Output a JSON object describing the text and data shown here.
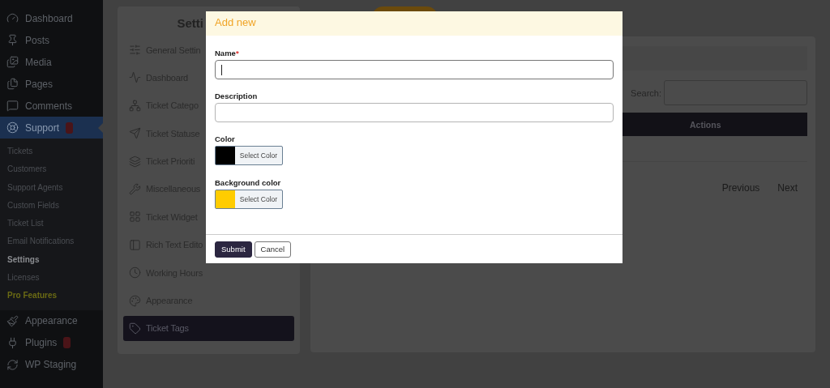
{
  "admin_menu": [
    {
      "label": "Dashboard",
      "selected": false,
      "badge": false
    },
    {
      "label": "Posts",
      "selected": false,
      "badge": false
    },
    {
      "label": "Media",
      "selected": false,
      "badge": false
    },
    {
      "label": "Pages",
      "selected": false,
      "badge": false
    },
    {
      "label": "Comments",
      "selected": false,
      "badge": false
    },
    {
      "label": "Support",
      "selected": true,
      "badge": true,
      "submenu": [
        {
          "label": "Tickets",
          "kind": "normal",
          "selected": false
        },
        {
          "label": "Customers",
          "kind": "normal",
          "selected": false
        },
        {
          "label": "Support Agents",
          "kind": "normal",
          "selected": false
        },
        {
          "label": "Custom Fields",
          "kind": "normal",
          "selected": false
        },
        {
          "label": "Ticket List",
          "kind": "normal",
          "selected": false
        },
        {
          "label": "Email Notifications",
          "kind": "normal",
          "selected": false
        },
        {
          "label": "Settings",
          "kind": "normal",
          "selected": true
        },
        {
          "label": "Licenses",
          "kind": "normal",
          "selected": false
        },
        {
          "label": "Pro Features",
          "kind": "pro",
          "selected": false
        }
      ]
    },
    {
      "label": "Appearance",
      "selected": false,
      "badge": false
    },
    {
      "label": "Plugins",
      "selected": false,
      "badge": true
    },
    {
      "label": "WP Staging",
      "selected": false,
      "badge": false
    }
  ],
  "settings_panel": {
    "title": "Setti",
    "items": [
      {
        "label": "General Settin",
        "selected": false
      },
      {
        "label": "Dashboard",
        "selected": false
      },
      {
        "label": "Ticket Catego",
        "selected": false
      },
      {
        "label": "Ticket Statuse",
        "selected": false
      },
      {
        "label": "Ticket Prioriti",
        "selected": false
      },
      {
        "label": "Miscellaneous",
        "selected": false
      },
      {
        "label": "Ticket Widget",
        "selected": false
      },
      {
        "label": "Rich Text Edito",
        "selected": false
      },
      {
        "label": "Working Hours",
        "selected": false
      },
      {
        "label": "Appearance",
        "selected": false
      },
      {
        "label": "Ticket Tags",
        "selected": true
      }
    ]
  },
  "content": {
    "search_label": "Search:",
    "table": {
      "columns": [
        "Actions"
      ]
    },
    "pagination": [
      "Previous",
      "Next"
    ]
  },
  "modal": {
    "title": "Add new",
    "fields": [
      {
        "kind": "text",
        "label": "Name",
        "required_mark": "*",
        "focused": true
      },
      {
        "kind": "text",
        "label": "Description",
        "focused": false
      },
      {
        "kind": "color",
        "label": "Color",
        "color": "#000000",
        "button": "Select Color"
      },
      {
        "kind": "color",
        "label": "Background color",
        "color": "#ffcc00",
        "button": "Select Color"
      }
    ],
    "buttons": [
      {
        "label": "Submit",
        "kind": "primary"
      },
      {
        "label": "Cancel",
        "kind": "secondary"
      }
    ]
  }
}
